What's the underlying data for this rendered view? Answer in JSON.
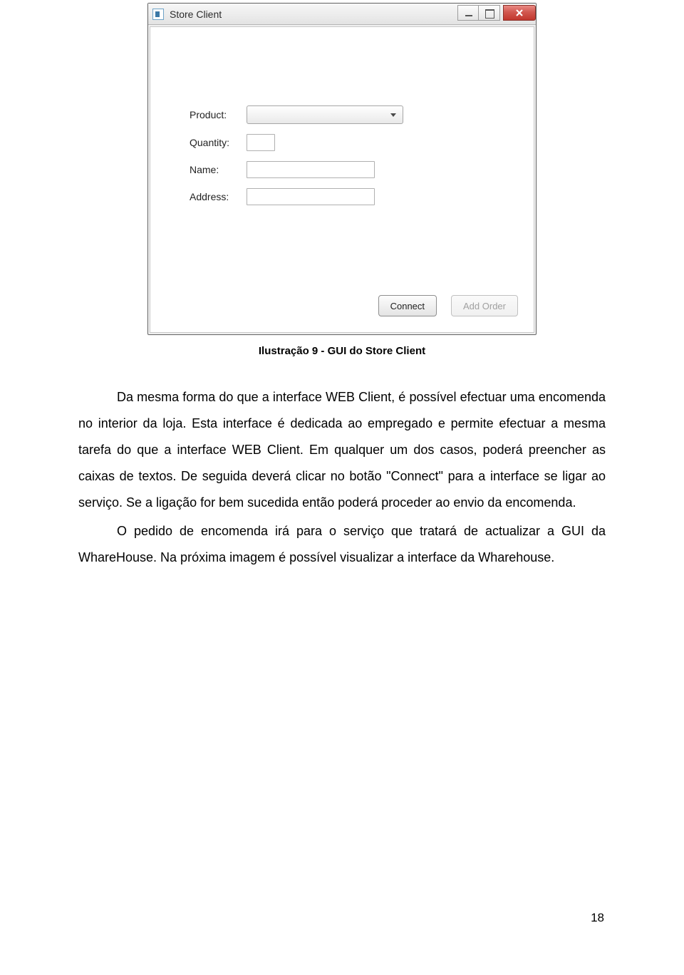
{
  "window": {
    "title": "Store Client",
    "fields": {
      "product_label": "Product:",
      "quantity_label": "Quantity:",
      "name_label": "Name:",
      "address_label": "Address:"
    },
    "buttons": {
      "connect": "Connect",
      "add_order": "Add Order"
    }
  },
  "caption": "Ilustração 9 - GUI do Store Client",
  "paragraphs": {
    "p1": "Da mesma forma do que a interface WEB Client, é possível efectuar uma encomenda no interior da loja. Esta interface é dedicada ao empregado e permite efectuar a mesma tarefa do que a interface WEB Client. Em qualquer um dos casos, poderá preencher as caixas de textos. De seguida deverá clicar no botão \"Connect\" para a interface se ligar ao serviço. Se a ligação for bem sucedida então poderá proceder ao envio da encomenda.",
    "p2": "O pedido de encomenda irá para o serviço que tratará de actualizar a GUI da WhareHouse. Na próxima imagem é possível visualizar a interface da Wharehouse."
  },
  "page_number": "18"
}
